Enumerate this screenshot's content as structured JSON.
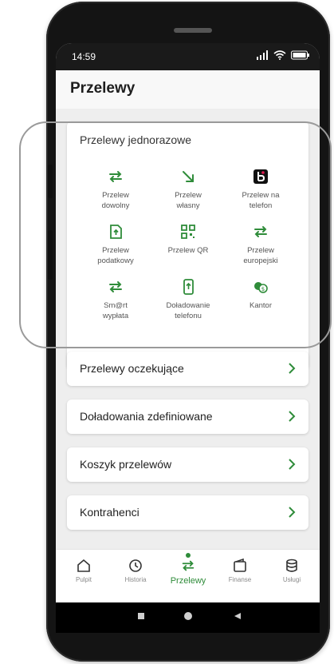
{
  "status_bar": {
    "time": "14:59"
  },
  "header": {
    "title": "Przelewy"
  },
  "one_time": {
    "title": "Przelewy jednorazowe",
    "items": [
      {
        "label": "Przelew\ndowolny",
        "icon": "transfer-arrows-icon"
      },
      {
        "label": "Przelew\nwłasny",
        "icon": "arrow-down-right-icon"
      },
      {
        "label": "Przelew na\ntelefon",
        "icon": "blik-icon"
      },
      {
        "label": "Przelew\npodatkowy",
        "icon": "tax-document-icon"
      },
      {
        "label": "Przelew QR",
        "icon": "qr-code-icon"
      },
      {
        "label": "Przelew\neuropejski",
        "icon": "transfer-arrows-icon"
      },
      {
        "label": "Sm@rt\nwypłata",
        "icon": "transfer-arrows-icon"
      },
      {
        "label": "Doładowanie\ntelefonu",
        "icon": "phone-topup-icon"
      },
      {
        "label": "Kantor",
        "icon": "currency-exchange-icon"
      }
    ]
  },
  "rows": [
    {
      "label": "Przelewy oczekujące"
    },
    {
      "label": "Doładowania zdefiniowane"
    },
    {
      "label": "Koszyk przelewów"
    },
    {
      "label": "Kontrahenci"
    }
  ],
  "bottom_nav": [
    {
      "label": "Pulpit",
      "icon": "home-icon"
    },
    {
      "label": "Historia",
      "icon": "history-icon"
    },
    {
      "label": "Przelewy",
      "icon": "transfer-arrows-icon",
      "active": true
    },
    {
      "label": "Finanse",
      "icon": "wallet-icon"
    },
    {
      "label": "Usługi",
      "icon": "database-icon"
    }
  ],
  "colors": {
    "accent": "#2f8c3a",
    "background": "#eeeeee",
    "card": "#ffffff"
  }
}
